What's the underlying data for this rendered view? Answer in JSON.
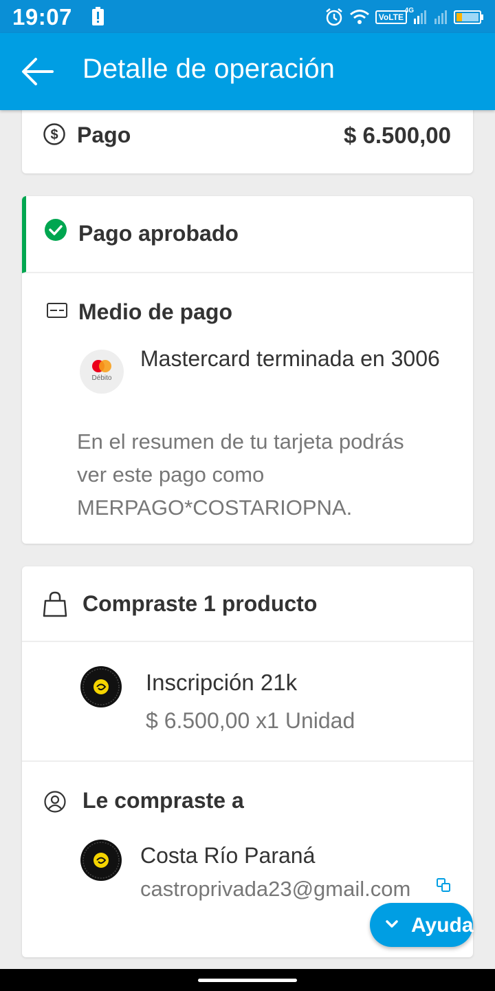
{
  "status_bar": {
    "time": "19:07",
    "network_badge": "VoLTE",
    "network_type": "4G"
  },
  "header": {
    "title": "Detalle de operación",
    "back_icon": "arrow-left-icon"
  },
  "payment": {
    "label": "Pago",
    "amount": "$ 6.500,00"
  },
  "status": {
    "label": "Pago aprobado",
    "color": "#00a650"
  },
  "payment_method": {
    "title": "Medio de pago",
    "card_type": "Débito",
    "card_description": "Mastercard terminada en 3006",
    "summary": "En el resumen de tu tarjeta podrás ver este pago como MERPAGO*COSTARIOPNA."
  },
  "purchase": {
    "title": "Compraste 1 producto",
    "product": {
      "name": "Inscripción 21k",
      "price": "$ 6.500,00 x1 Unidad"
    }
  },
  "seller": {
    "title": "Le compraste a",
    "name": "Costa Río Paraná",
    "email": "castroprivada23@gmail.com"
  },
  "help": {
    "label": "Ayuda"
  },
  "colors": {
    "app_bar": "#009ee3",
    "status_bar": "#0a8fd6",
    "approved": "#00a650",
    "background": "#ededed"
  }
}
